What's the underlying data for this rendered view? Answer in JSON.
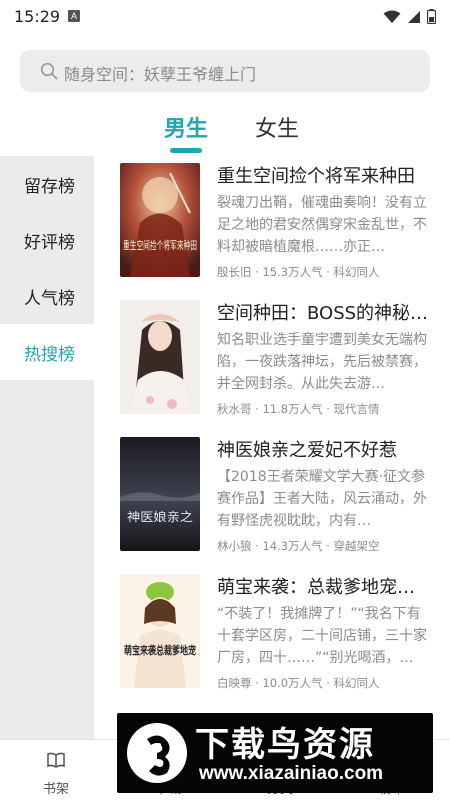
{
  "status_bar": {
    "time": "15:29",
    "badge": "A"
  },
  "search": {
    "placeholder": "随身空间：妖孽王爷缠上门"
  },
  "gender_tabs": [
    {
      "label": "男生",
      "active": true
    },
    {
      "label": "女生",
      "active": false
    }
  ],
  "rank_tabs": [
    {
      "label": "留存榜",
      "active": false
    },
    {
      "label": "好评榜",
      "active": false
    },
    {
      "label": "人气榜",
      "active": false
    },
    {
      "label": "热搜榜",
      "active": true
    }
  ],
  "books": [
    {
      "title": "重生空间捡个将军来种田",
      "desc": "裂魂刀出鞘，催魂曲奏响！没有立足之地的君安然偶穿宋金乱世，不料却被暗植魔根……亦正…",
      "meta": "殷长旧 · 15.3万人气 · 科幻同人",
      "cover_text": "重生空间捡个将军来种田"
    },
    {
      "title": "空间种田：BOSS的神秘…",
      "desc": "知名职业选手童宇遭到美女无端构陷，一夜跌落神坛，先后被禁赛，并全网封杀。从此失去游…",
      "meta": "秋水哥 · 11.8万人气 · 现代言情",
      "cover_text": ""
    },
    {
      "title": "神医娘亲之爱妃不好惹",
      "desc": "【2018王者荣耀文学大赛·征文参赛作品】王者大陆，风云涌动，外有野怪虎视眈眈，内有…",
      "meta": "林小狼 · 14.3万人气 · 穿越架空",
      "cover_text": "神医娘亲之"
    },
    {
      "title": "萌宝来袭：总裁爹地宠…",
      "desc": "“不装了！我摊牌了！”“我名下有十套学区房，二十间店铺，三十家厂房，四十……”“别光喝酒，…",
      "meta": "白映尊 · 10.0万人气 · 科幻同人",
      "cover_text": "萌宝来袭总裁爹地宠"
    }
  ],
  "bottom_nav": [
    {
      "label": "书架",
      "icon": "book-open-icon"
    },
    {
      "label": "书城",
      "icon": "store-icon"
    },
    {
      "label": "分类",
      "icon": "category-icon"
    },
    {
      "label": "榜单",
      "icon": "ranking-icon"
    }
  ],
  "watermark": {
    "title": "下载鸟资源",
    "url": "www.xiazainiao.com"
  },
  "colors": {
    "accent": "#1fa6b5",
    "sidebar_bg": "#ebebeb",
    "muted_text": "#8c8c8c"
  }
}
